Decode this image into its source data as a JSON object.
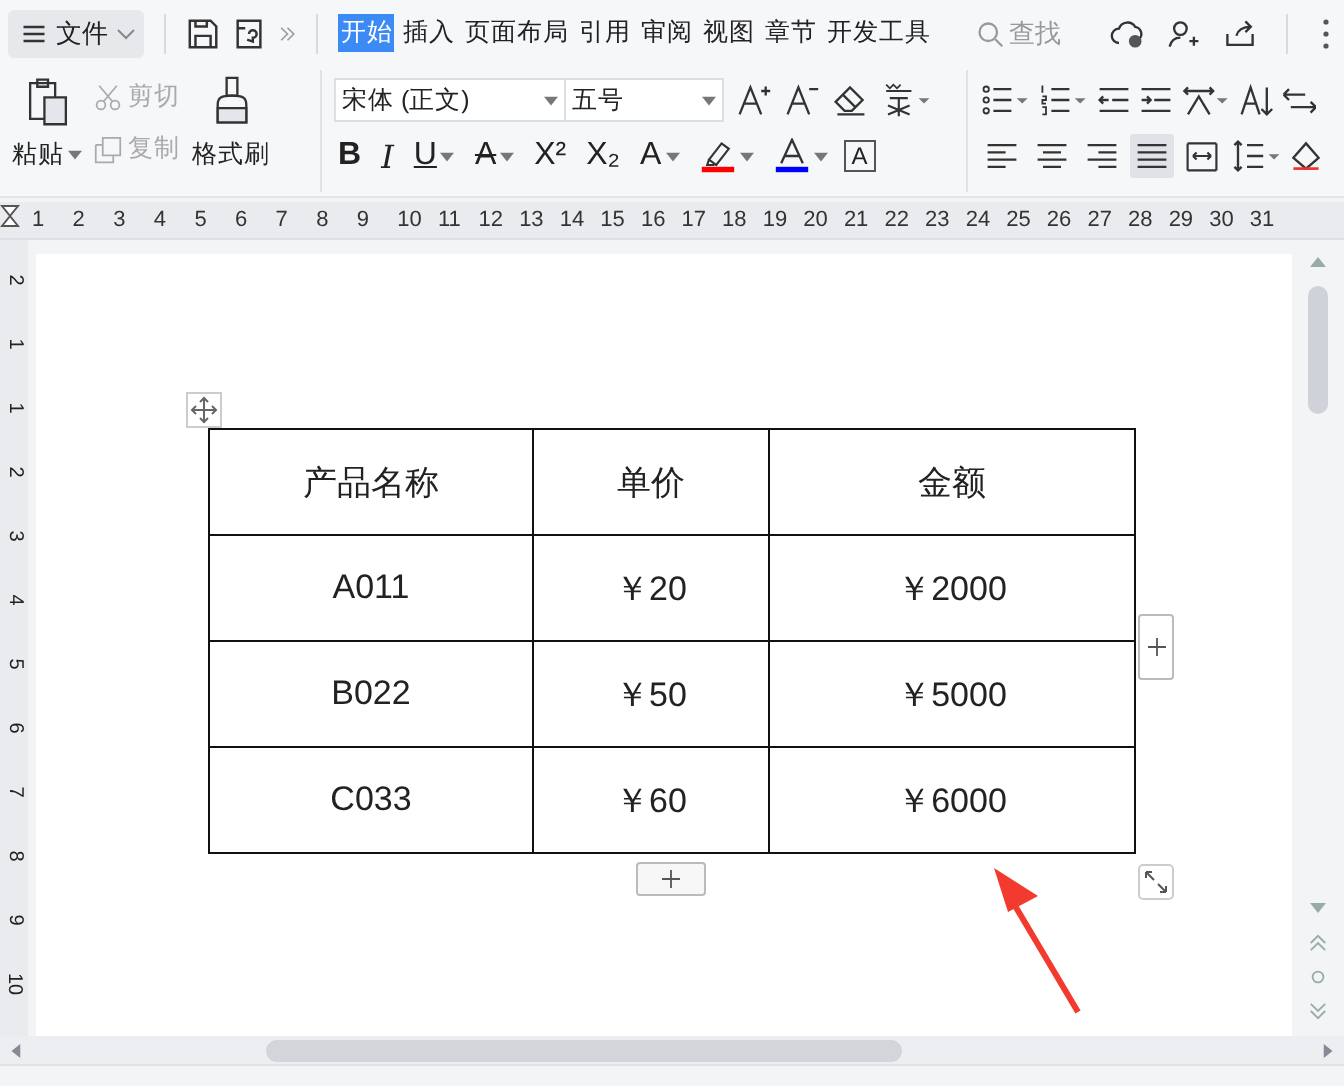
{
  "top_bar": {
    "file_menu": "文件",
    "tabs": [
      {
        "label": "开始",
        "selected": true
      },
      {
        "label": "插入",
        "selected": false
      },
      {
        "label": "页面布局",
        "selected": false
      },
      {
        "label": "引用",
        "selected": false
      },
      {
        "label": "审阅",
        "selected": false
      },
      {
        "label": "视图",
        "selected": false
      },
      {
        "label": "章节",
        "selected": false
      },
      {
        "label": "开发工具",
        "selected": false
      }
    ],
    "search": {
      "placeholder": "查找"
    }
  },
  "ribbon": {
    "paste": "粘贴",
    "cut": "剪切",
    "copy": "复制",
    "format_painter": "格式刷",
    "font_name": "宋体 (正文)",
    "font_size": "五号",
    "font_tools": [
      {
        "label": "B",
        "dropdown": false
      },
      {
        "label": "I",
        "dropdown": false
      },
      {
        "label": "U",
        "dropdown": true
      },
      {
        "label": "A",
        "dropdown": true
      },
      {
        "label": "X²",
        "dropdown": false
      },
      {
        "label": "X₂",
        "dropdown": false
      },
      {
        "label": "A",
        "dropdown": true
      }
    ],
    "color_tools": [
      {
        "kind": "highlighter",
        "color": "#ff0000"
      },
      {
        "kind": "font-color",
        "color": "#0000ff"
      }
    ],
    "char_border": "A",
    "alignment": [
      {
        "kind": "left",
        "selected": false
      },
      {
        "kind": "center",
        "selected": false
      },
      {
        "kind": "right",
        "selected": false
      },
      {
        "kind": "justify",
        "selected": true
      },
      {
        "kind": "distributed",
        "selected": false
      }
    ]
  },
  "ruler": [
    "1",
    "2",
    "3",
    "4",
    "5",
    "6",
    "7",
    "8",
    "9",
    "10",
    "11",
    "12",
    "13",
    "14",
    "15",
    "16",
    "17",
    "18",
    "19",
    "20",
    "21",
    "22",
    "23",
    "24",
    "25",
    "26",
    "27",
    "28",
    "29",
    "30",
    "31"
  ],
  "vertical_ruler": [
    "2",
    "1",
    "1",
    "2",
    "3",
    "4",
    "5",
    "6",
    "7",
    "8",
    "9",
    "10"
  ],
  "table": {
    "rows": [
      [
        "产品名称",
        "单价",
        "金额"
      ],
      [
        "A011",
        "￥20",
        "￥2000"
      ],
      [
        "B022",
        "￥50",
        "￥5000"
      ],
      [
        "C033",
        "￥60",
        "￥6000"
      ]
    ]
  }
}
